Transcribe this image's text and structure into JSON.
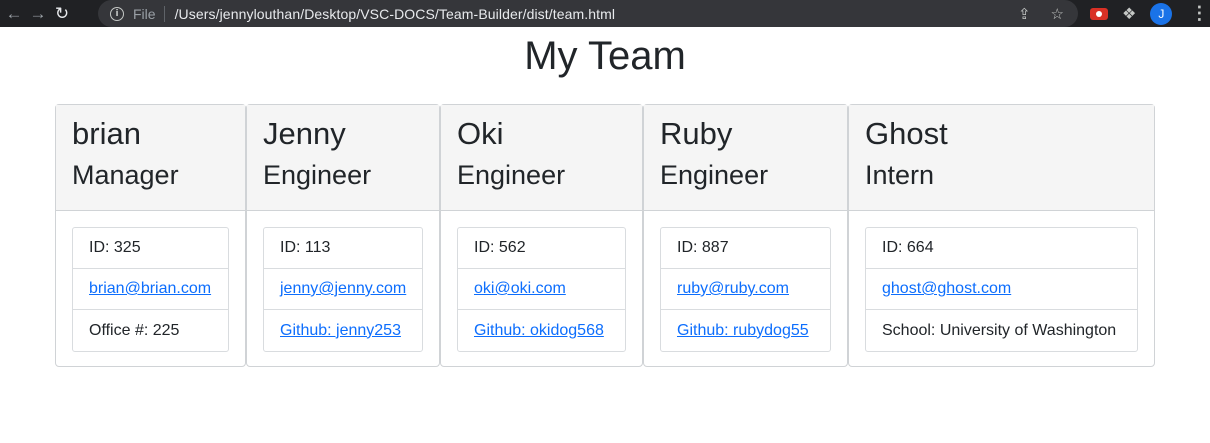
{
  "browser": {
    "file_label": "File",
    "url": "/Users/jennylouthan/Desktop/VSC-DOCS/Team-Builder/dist/team.html",
    "avatar_initial": "J"
  },
  "page": {
    "title": "My Team"
  },
  "team": [
    {
      "name": "brian",
      "role": "Manager",
      "id": "ID: 325",
      "email": "brian@brian.com",
      "extra": "Office #: 225",
      "extra_is_link": false
    },
    {
      "name": "Jenny",
      "role": "Engineer",
      "id": "ID: 113",
      "email": "jenny@jenny.com",
      "extra": "Github: jenny253",
      "extra_is_link": true
    },
    {
      "name": "Oki",
      "role": "Engineer",
      "id": "ID: 562",
      "email": "oki@oki.com",
      "extra": "Github: okidog568",
      "extra_is_link": true
    },
    {
      "name": "Ruby",
      "role": "Engineer",
      "id": "ID: 887",
      "email": "ruby@ruby.com",
      "extra": "Github: rubydog55",
      "extra_is_link": true
    },
    {
      "name": "Ghost",
      "role": "Intern",
      "id": "ID: 664",
      "email": "ghost@ghost.com",
      "extra": "School: University of Washington",
      "extra_is_link": false
    }
  ],
  "colors": {
    "link": "#0d6efd",
    "header_bg": "#f5f5f5",
    "chrome_bg": "#202124"
  }
}
